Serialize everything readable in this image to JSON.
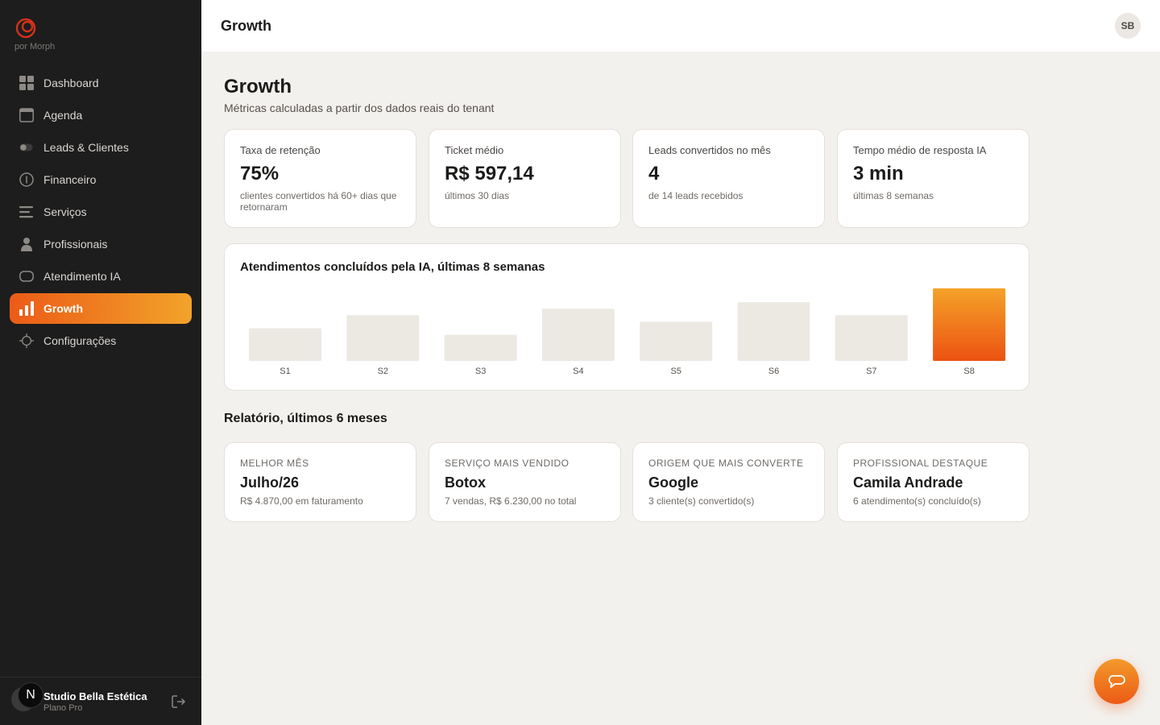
{
  "brand": {
    "sub": "por Morph",
    "color": "#d2311b"
  },
  "nav": [
    {
      "label": "Dashboard",
      "icon": "dashboard-icon"
    },
    {
      "label": "Agenda",
      "icon": "calendar-icon"
    },
    {
      "label": "Leads & Clientes",
      "icon": "toggle-icon"
    },
    {
      "label": "Financeiro",
      "icon": "info-circle-icon"
    },
    {
      "label": "Serviços",
      "icon": "list-icon"
    },
    {
      "label": "Profissionais",
      "icon": "person-icon"
    },
    {
      "label": "Atendimento IA",
      "icon": "chat-bubble-icon"
    },
    {
      "label": "Growth",
      "icon": "bar-chart-icon",
      "active": true
    },
    {
      "label": "Configurações",
      "icon": "settings-crosshair-icon"
    }
  ],
  "footer": {
    "avatar": "N",
    "studio": "Studio Bella Estética",
    "plan": "Plano Pro"
  },
  "topbar": {
    "title": "Growth",
    "user_initials": "SB"
  },
  "page": {
    "title": "Growth",
    "subtitle": "Métricas calculadas a partir dos dados reais do tenant"
  },
  "kpis": [
    {
      "label": "Taxa de retenção",
      "value": "75%",
      "note": "clientes convertidos há 60+ dias que retornaram"
    },
    {
      "label": "Ticket médio",
      "value": "R$ 597,14",
      "note": "últimos 30 dias"
    },
    {
      "label": "Leads convertidos no mês",
      "value": "4",
      "note": "de 14 leads recebidos"
    },
    {
      "label": "Tempo médio de resposta IA",
      "value": "3 min",
      "note": "últimas 8 semanas"
    }
  ],
  "chart_data": {
    "type": "bar",
    "title": "Atendimentos concluídos pela IA, últimas 8 semanas",
    "categories": [
      "S1",
      "S2",
      "S3",
      "S4",
      "S5",
      "S6",
      "S7",
      "S8"
    ],
    "values": [
      4.5,
      6.3,
      3.6,
      7.2,
      5.4,
      8.1,
      6.3,
      10
    ],
    "ylim": [
      0,
      10
    ],
    "highlight_index": 7,
    "colors": {
      "bar": "#ece9e3",
      "highlight_top": "#f4a228",
      "highlight_bottom": "#ec5212",
      "tick": "#55514d"
    }
  },
  "report": {
    "title": "Relatório, últimos 6 meses",
    "cards": [
      {
        "label": "MELHOR MÊS",
        "value": "Julho/26",
        "note": "R$ 4.870,00 em faturamento"
      },
      {
        "label": "SERVIÇO MAIS VENDIDO",
        "value": "Botox",
        "note": "7 vendas, R$ 6.230,00 no total"
      },
      {
        "label": "ORIGEM QUE MAIS CONVERTE",
        "value": "Google",
        "note": "3 cliente(s) convertido(s)"
      },
      {
        "label": "PROFISSIONAL DESTAQUE",
        "value": "Camila Andrade",
        "note": "6 atendimento(s) concluído(s)"
      }
    ]
  }
}
